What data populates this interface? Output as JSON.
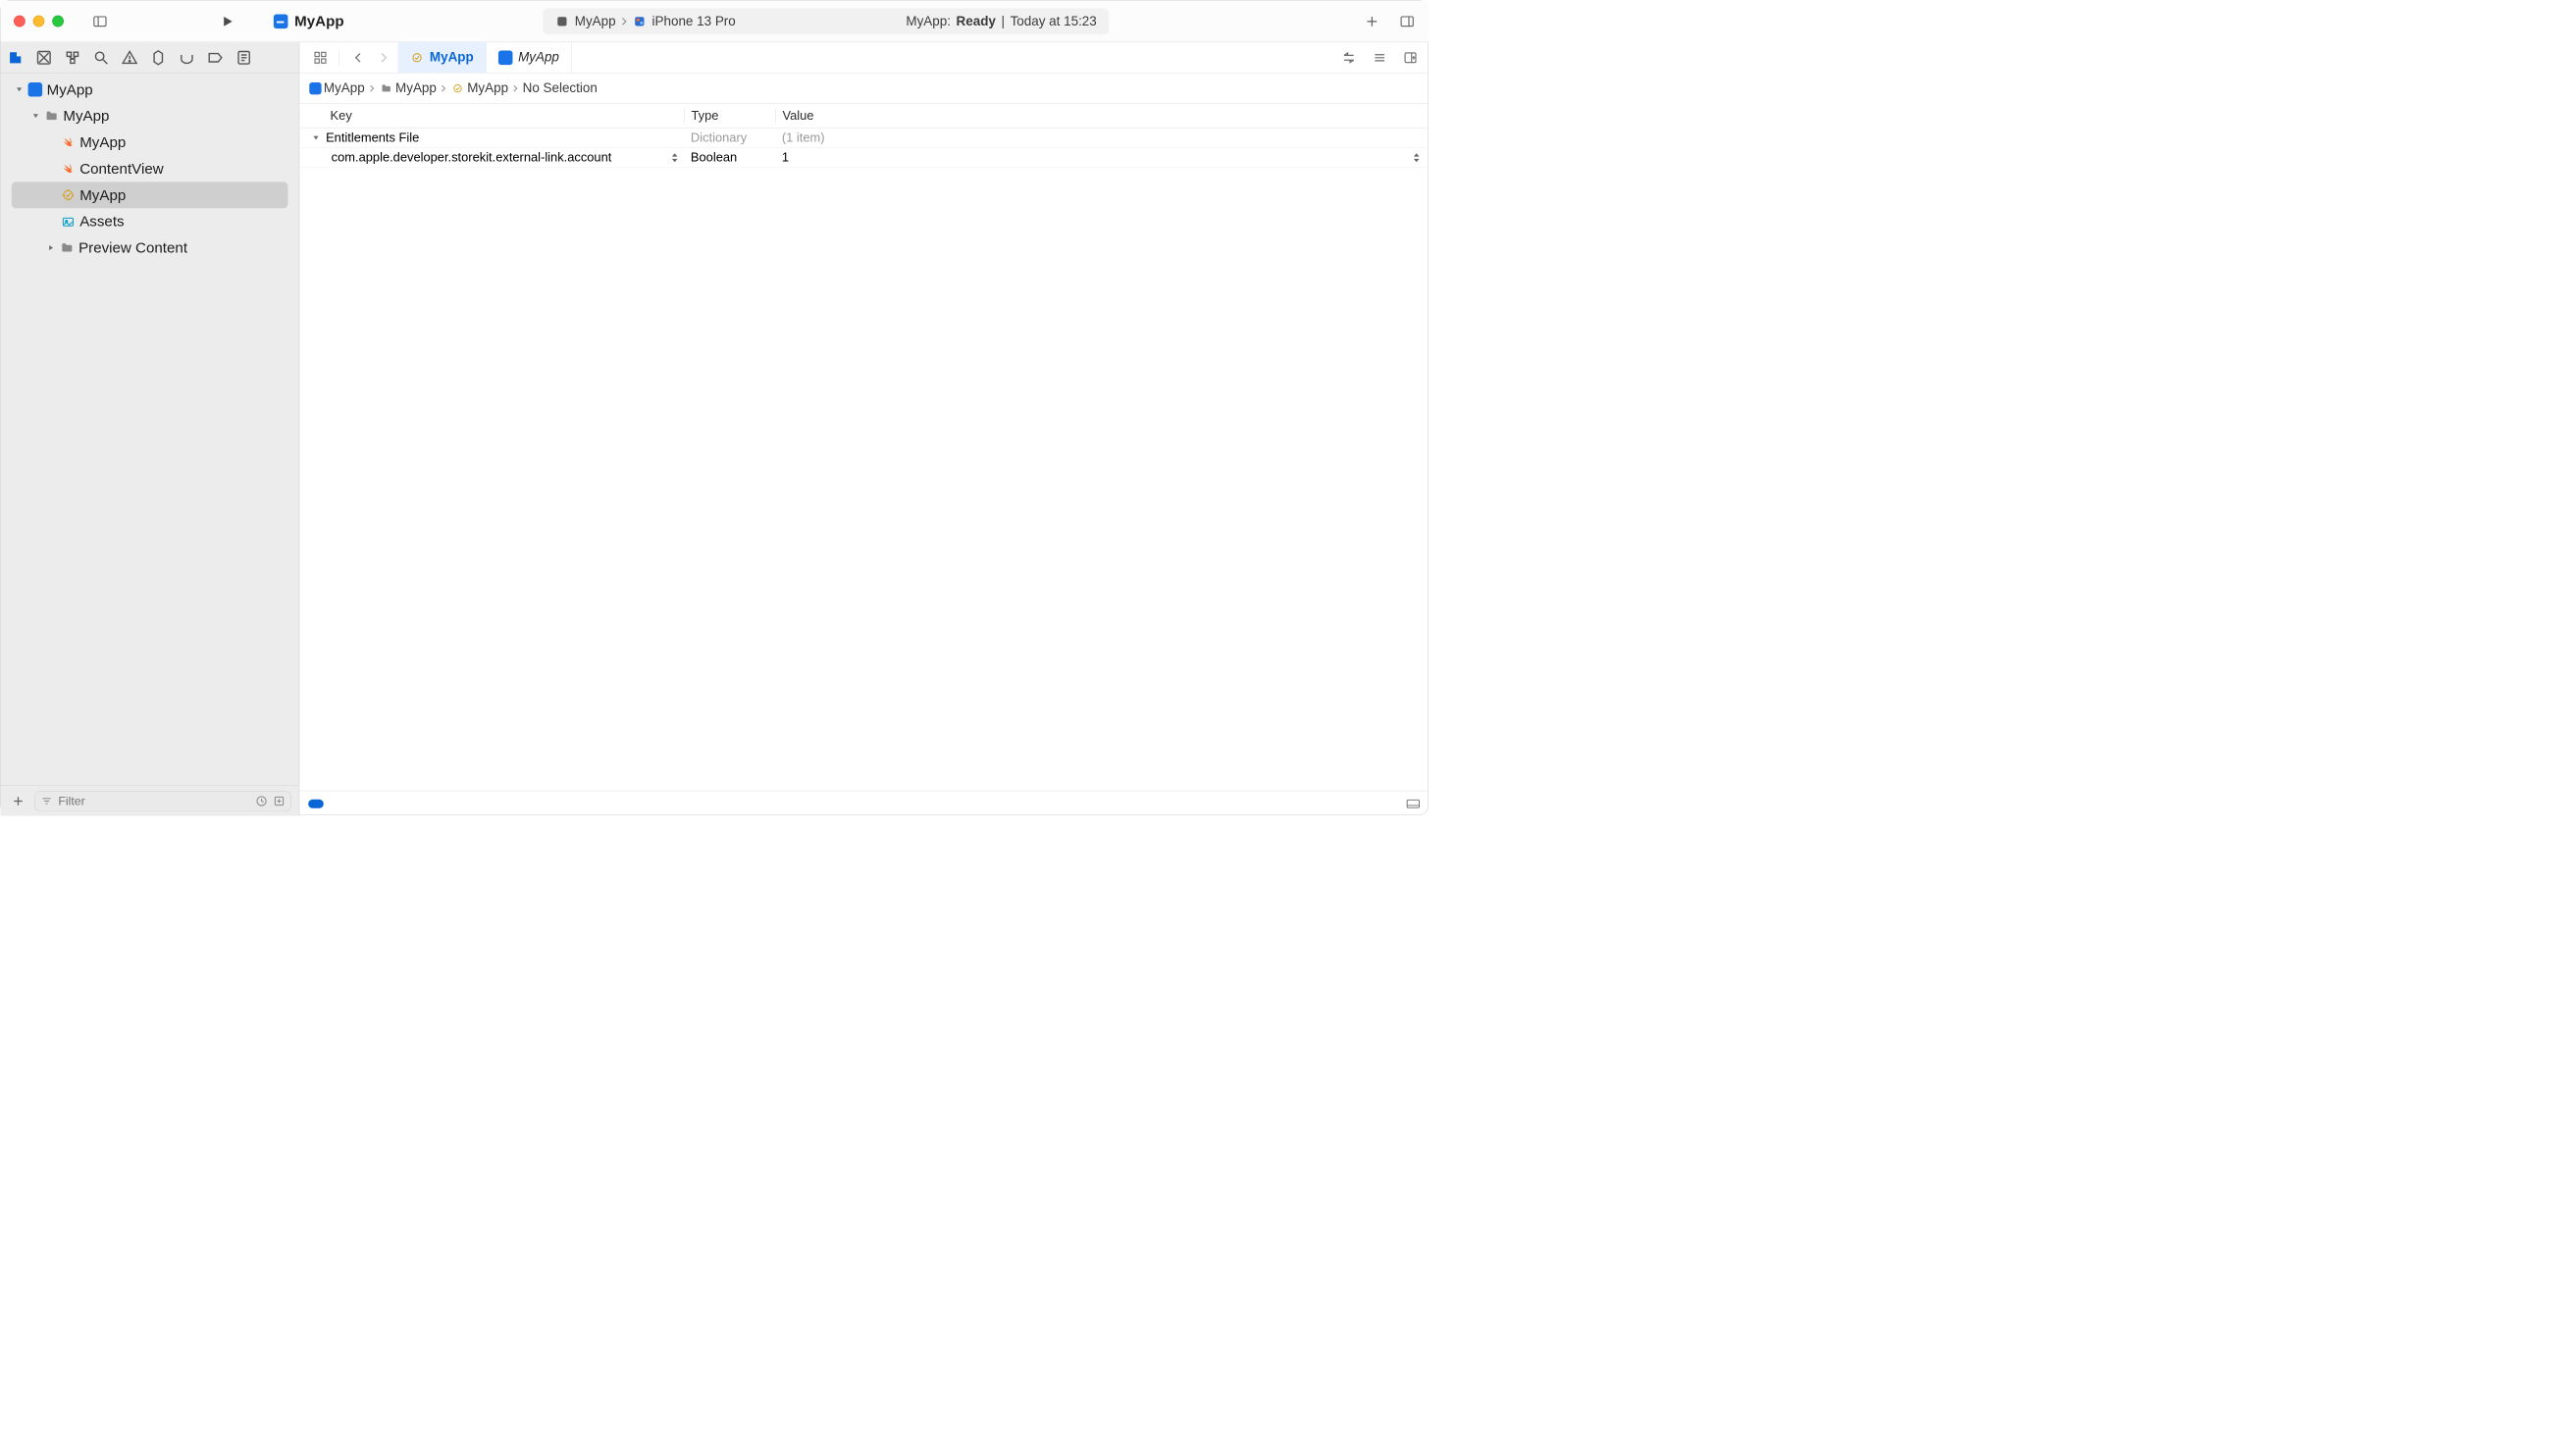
{
  "toolbar": {
    "title": "MyApp",
    "scheme_app": "MyApp",
    "device": "iPhone 13 Pro",
    "status_prefix": "MyApp:",
    "status_ready": "Ready",
    "status_time": "Today at 15:23"
  },
  "navigator": {
    "root": "MyApp",
    "group": "MyApp",
    "items": [
      {
        "name": "MyApp",
        "kind": "swift"
      },
      {
        "name": "ContentView",
        "kind": "swift"
      },
      {
        "name": "MyApp",
        "kind": "entitlements",
        "selected": true
      },
      {
        "name": "Assets",
        "kind": "assets"
      }
    ],
    "folder2": "Preview Content",
    "filter_placeholder": "Filter"
  },
  "tabs": {
    "active": "MyApp",
    "secondary": "MyApp"
  },
  "breadcrumbs": {
    "parts": [
      "MyApp",
      "MyApp",
      "MyApp",
      "No Selection"
    ]
  },
  "plist": {
    "headers": {
      "key": "Key",
      "type": "Type",
      "value": "Value"
    },
    "root": {
      "key": "Entitlements File",
      "type": "Dictionary",
      "value": "(1 item)"
    },
    "rows": [
      {
        "key": "com.apple.developer.storekit.external-link.account",
        "type": "Boolean",
        "value": "1"
      }
    ]
  }
}
